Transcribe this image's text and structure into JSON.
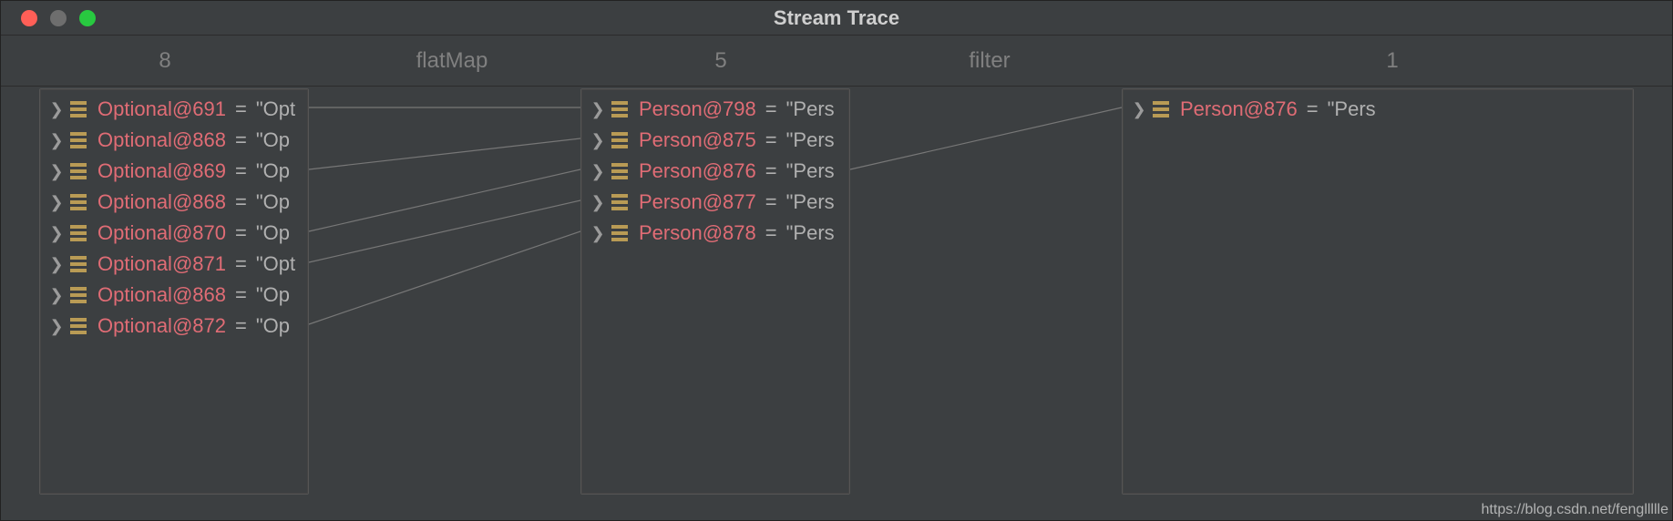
{
  "window": {
    "title": "Stream Trace"
  },
  "columns": {
    "col1": {
      "count": "8"
    },
    "op1": {
      "label": "flatMap"
    },
    "col2": {
      "count": "5"
    },
    "op2": {
      "label": "filter"
    },
    "col3": {
      "count": "1"
    }
  },
  "panel1": {
    "rows": [
      {
        "name": "Optional@691",
        "eq": " = ",
        "val": "\"Opt"
      },
      {
        "name": "Optional@868",
        "eq": " = ",
        "val": "\"Op"
      },
      {
        "name": "Optional@869",
        "eq": " = ",
        "val": "\"Op"
      },
      {
        "name": "Optional@868",
        "eq": " = ",
        "val": "\"Op"
      },
      {
        "name": "Optional@870",
        "eq": " = ",
        "val": "\"Op"
      },
      {
        "name": "Optional@871",
        "eq": " = ",
        "val": "\"Opt"
      },
      {
        "name": "Optional@868",
        "eq": " = ",
        "val": "\"Op"
      },
      {
        "name": "Optional@872",
        "eq": " = ",
        "val": "\"Op"
      }
    ]
  },
  "panel2": {
    "rows": [
      {
        "name": "Person@798",
        "eq": " = ",
        "val": "\"Pers"
      },
      {
        "name": "Person@875",
        "eq": " = ",
        "val": "\"Pers"
      },
      {
        "name": "Person@876",
        "eq": " = ",
        "val": "\"Pers"
      },
      {
        "name": "Person@877",
        "eq": " = ",
        "val": "\"Pers"
      },
      {
        "name": "Person@878",
        "eq": " = ",
        "val": "\"Pers"
      }
    ]
  },
  "panel3": {
    "rows": [
      {
        "name": "Person@876",
        "eq": " = ",
        "val": "\"Pers"
      }
    ]
  },
  "watermark": "https://blog.csdn.net/fengllllle"
}
